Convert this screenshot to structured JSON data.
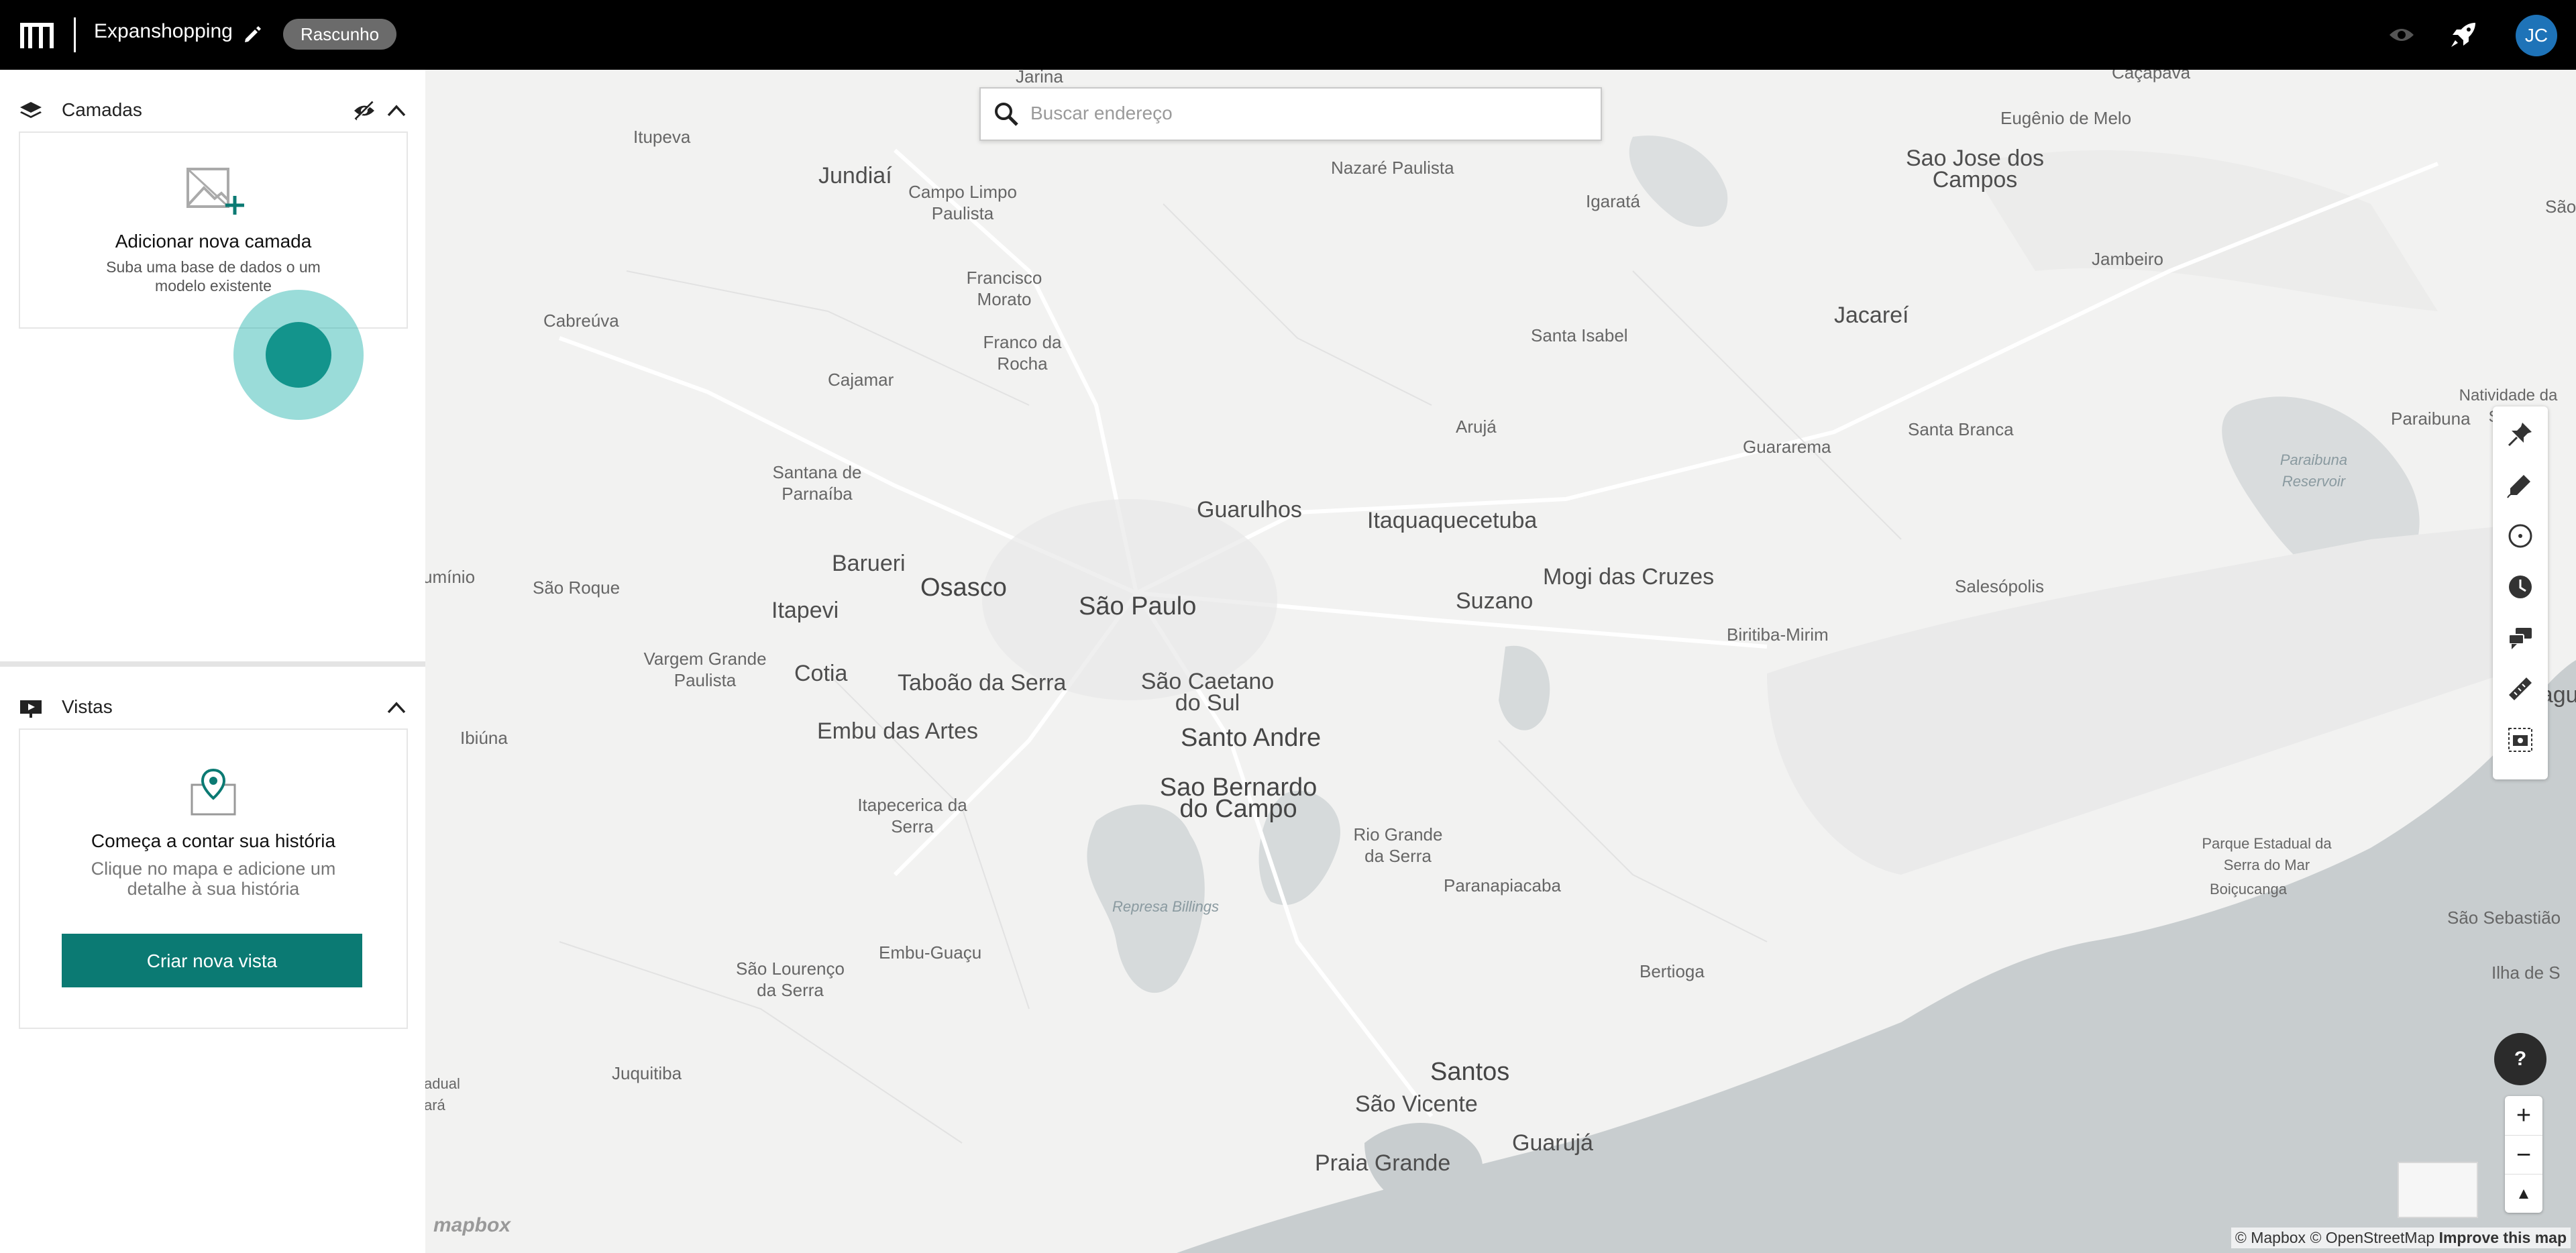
{
  "header": {
    "project_name": "Expanshopping",
    "status_badge": "Rascunho",
    "user_initials": "JC"
  },
  "layers": {
    "title": "Camadas",
    "empty_title": "Adicionar nova camada",
    "empty_desc_line1": "Suba uma base de dados o",
    "empty_desc_line1_end": "um",
    "empty_desc_line2": "modelo existente"
  },
  "views": {
    "title": "Vistas",
    "empty_title": "Começa a contar sua história",
    "empty_desc": "Clique no mapa e adicione um detalhe à sua história",
    "create_button": "Criar nova vista"
  },
  "map": {
    "search_placeholder": "Buscar endereço",
    "help_label": "?",
    "zoom_in": "+",
    "zoom_out": "−",
    "compass": "▲",
    "mapbox_logo": "mapbox",
    "attribution_1": "© Mapbox",
    "attribution_2": "© OpenStreetMap",
    "attribution_3": "Improve this map",
    "places": {
      "jarina": "Jarina",
      "cacapava": "Caçapava",
      "eugenio": "Eugênio de Melo",
      "itupeva": "Itupeva",
      "jundiai": "Jundiaí",
      "campo_limpo": "Campo Limpo Paulista",
      "nazare": "Nazaré Paulista",
      "igarata": "Igaratá",
      "sjc": "Sao Jose dos Campos",
      "sao": "São",
      "jambeiro": "Jambeiro",
      "cabreuva": "Cabreúva",
      "francisco_morato": "Francisco Morato",
      "franco_rocha": "Franco da Rocha",
      "santa_isabel": "Santa Isabel",
      "jacarei": "Jacareí",
      "cajamar": "Cajamar",
      "natividade": "Natividade da Serra",
      "aruja": "Arujá",
      "guararema": "Guararema",
      "santa_branca": "Santa Branca",
      "paraibuna": "Paraibuna",
      "paraibuna_res": "Paraibuna Reservoir",
      "santana": "Santana de Parnaíba",
      "guarulhos": "Guarulhos",
      "itaquaquecetuba": "Itaquaquecetuba",
      "barueri": "Barueri",
      "aluminio": "umínio",
      "sao_roque": "São Roque",
      "osasco": "Osasco",
      "sao_paulo": "São Paulo",
      "mogi": "Mogi das Cruzes",
      "itapevi": "Itapevi",
      "suzano": "Suzano",
      "salesopolis": "Salesópolis",
      "biritiba": "Biritiba-Mirim",
      "vargem": "Vargem Grande Paulista",
      "cotia": "Cotia",
      "taboao": "Taboão da Serra",
      "sao_caetano": "São Caetano do Sul",
      "caraguat": "Caraguat",
      "ibiuna": "Ibiúna",
      "embu": "Embu das Artes",
      "santo_andre": "Santo Andre",
      "itapecerica": "Itapecerica da Serra",
      "sbc": "Sao Bernardo do Campo",
      "rio_grande": "Rio Grande da Serra",
      "parque": "Parque Estadual da Serra do Mar",
      "boicucanga": "Boiçucanga",
      "paranapiacaba": "Paranapiacaba",
      "represa": "Represa Billings",
      "sao_sebastiao": "São Sebastião",
      "embu_guacu": "Embu-Guaçu",
      "sao_lourenco": "São Lourenço da Serra",
      "bertioga": "Bertioga",
      "ilha": "Ilha de S",
      "tapiral": "adual ará",
      "juquitiba": "Juquitiba",
      "santos": "Santos",
      "sao_vicente": "São Vicente",
      "guaruja": "Guarujá",
      "praia_grande": "Praia Grande"
    }
  },
  "colors": {
    "accent": "#0b7a73",
    "topbar": "#000000",
    "avatar": "#1e73b8",
    "water": "#c8cdcf",
    "land": "#f2f2f1"
  }
}
